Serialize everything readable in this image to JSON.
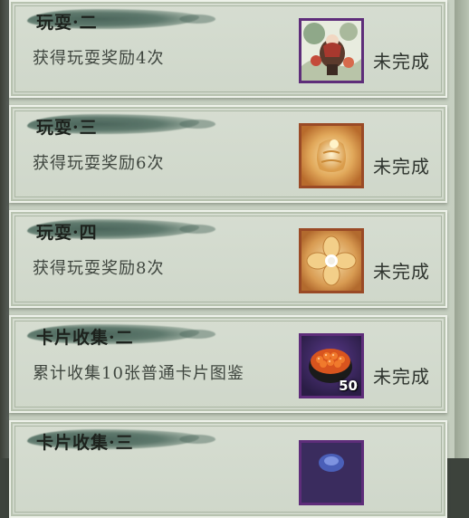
{
  "tasks": [
    {
      "title": "玩耍·二",
      "desc": "获得玩耍奖励4次",
      "status": "未完成",
      "reward_icon": "illustrated-card-icon",
      "reward_count": ""
    },
    {
      "title": "玩耍·三",
      "desc": "获得玩耍奖励6次",
      "status": "未完成",
      "reward_icon": "golden-bell-icon",
      "reward_count": ""
    },
    {
      "title": "玩耍·四",
      "desc": "获得玩耍奖励8次",
      "status": "未完成",
      "reward_icon": "golden-flower-icon",
      "reward_count": ""
    },
    {
      "title": "卡片收集·二",
      "desc": "累计收集10张普通卡片图鉴",
      "status": "未完成",
      "reward_icon": "sushi-icon",
      "reward_count": "50"
    },
    {
      "title": "卡片收集·三",
      "desc": "",
      "status": "",
      "reward_icon": "purple-item-icon",
      "reward_count": ""
    }
  ]
}
